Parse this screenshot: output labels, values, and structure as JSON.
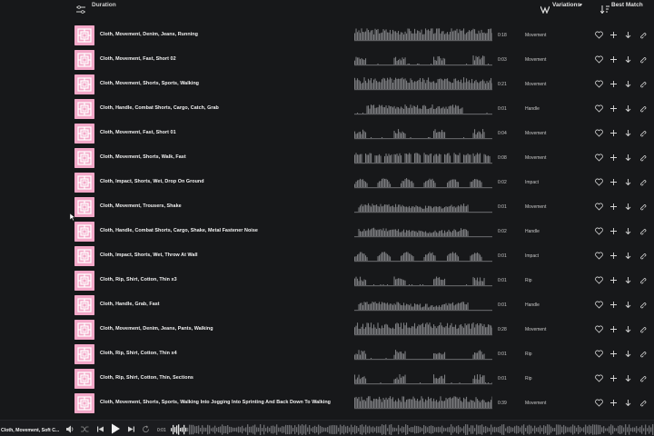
{
  "toolbar": {
    "duration_label": "Duration",
    "variations_label": "Variations",
    "sort_label": "Best Match"
  },
  "rows": [
    {
      "title": "Cloth, Movement, Denim, Jeans, Running",
      "duration": "0:18",
      "category": "Movement"
    },
    {
      "title": "Cloth, Movement, Fast, Short 02",
      "duration": "0:03",
      "category": "Movement"
    },
    {
      "title": "Cloth, Movement, Shorts, Sports, Walking",
      "duration": "0:21",
      "category": "Movement"
    },
    {
      "title": "Cloth, Handle, Combat Shorts, Cargo, Catch, Grab",
      "duration": "0:01",
      "category": "Handle"
    },
    {
      "title": "Cloth, Movement, Fast, Short 01",
      "duration": "0:04",
      "category": "Movement"
    },
    {
      "title": "Cloth, Movement, Shorts, Walk, Fast",
      "duration": "0:08",
      "category": "Movement"
    },
    {
      "title": "Cloth, Impact, Shorts, Wet, Drop On Ground",
      "duration": "0:02",
      "category": "Impact"
    },
    {
      "title": "Cloth, Movement, Trousers, Shake",
      "duration": "0:01",
      "category": "Movement"
    },
    {
      "title": "Cloth, Handle, Combat Shorts, Cargo, Shake, Metal Fastener Noise",
      "duration": "0:02",
      "category": "Handle"
    },
    {
      "title": "Cloth, Impact, Shorts, Wet, Throw At Wall",
      "duration": "0:01",
      "category": "Impact"
    },
    {
      "title": "Cloth, Rip, Shirt, Cotton, Thin x3",
      "duration": "0:01",
      "category": "Rip"
    },
    {
      "title": "Cloth, Handle, Grab, Fast",
      "duration": "0:01",
      "category": "Handle"
    },
    {
      "title": "Cloth, Movement, Denim, Jeans, Pants, Walking",
      "duration": "0:28",
      "category": "Movement"
    },
    {
      "title": "Cloth, Rip, Shirt, Cotton, Thin x4",
      "duration": "0:01",
      "category": "Rip"
    },
    {
      "title": "Cloth, Rip, Shirt, Cotton, Thin, Sections",
      "duration": "0:01",
      "category": "Rip"
    },
    {
      "title": "Cloth, Movement, Shorts, Sports, Walking Into Jogging Into Sprinting And Back Down To Walking",
      "duration": "0:39",
      "category": "Movement"
    }
  ],
  "player": {
    "title": "Cloth, Movement, Soft C...",
    "time": "0:01"
  },
  "colors": {
    "background": "#17181a",
    "thumbnail": "#f3a8c8",
    "waveform": "#7a7b7e"
  }
}
